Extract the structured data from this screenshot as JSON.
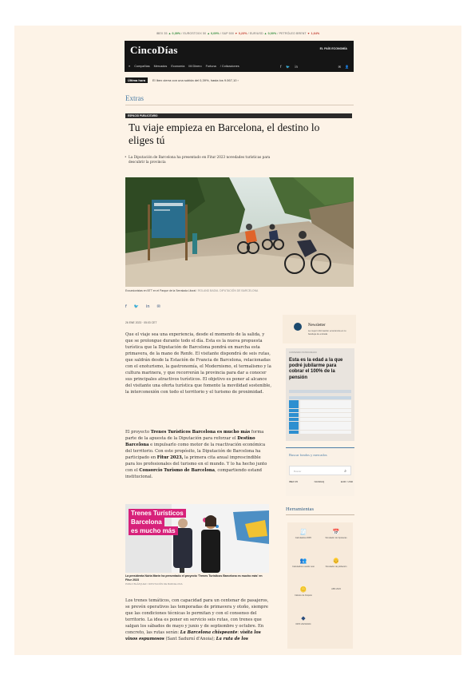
{
  "ticker": {
    "items": [
      {
        "name": "IBEX 35",
        "arrow": "▲",
        "value": "0,39%",
        "dir": "up"
      },
      {
        "name": "EUROSTOXX 50",
        "arrow": "▲",
        "value": "0,09%",
        "dir": "up"
      },
      {
        "name": "S&P 500",
        "arrow": "▼",
        "value": "0,23%",
        "dir": "down"
      },
      {
        "name": "EUR/USD",
        "arrow": "▲",
        "value": "0,00%",
        "dir": "up"
      },
      {
        "name": "PETRÓLEO BRENT",
        "arrow": "▼",
        "value": "1,64%",
        "dir": "down"
      }
    ]
  },
  "header": {
    "logo": "CincoDías",
    "partner": "EL PAÍS ECONOMÍA",
    "nav": [
      "Compañías",
      "Mercados",
      "Economía",
      "Mi Dinero",
      "Fortuna",
      "/ Cotizaciones"
    ],
    "menu_icon": "≡",
    "social_icons": [
      "f",
      "🐦",
      "in"
    ],
    "right_icons": [
      "✉",
      "👤"
    ]
  },
  "last_hour": {
    "tag": "Última hora",
    "text": "El Ibex cierra con una subida del 0,39%, hasta los 9.067,10 ›"
  },
  "section": "Extras",
  "article": {
    "promo_label": "ESPACIO PUBLICITARIO",
    "headline": "Tu viaje empieza en Barcelona, el destino lo eliges tú",
    "subhead": "La Diputación de Barcelona ha presentado en Fitur 2023 novedades turísticas para descubrir la provincia",
    "photo_caption": "Excursionistas en BTT en el Parque de la Serralada Litoral",
    "photo_credit": " / ROLAND BADIA. DIPUTACIÓN DE BARCELONA",
    "date": "26 ENE 2023 · 05:03 CET",
    "paragraph1": "Que el viaje sea una experiencia, desde el momento de la salida, y que se prolongue durante todo el día. Esta es la nueva propuesta turística que la Diputación de Barcelona pondrá en marcha esta primavera, de la mano de Renfe. El visitante dispondrá de seis rutas, que saldrán desde la Estación de Francia de Barcelona, relacionadas con el enoturismo, la gastronomía, el Modernismo, el termalismo y la cultura marinera, y que recorrerán la provincia para dar a conocer sus principales atractivos turísticos. El objetivo es poner al alcance del visitante una oferta turística que fomente la movilidad sostenible, la interconexión con todo el territorio y el turismo de proximidad.",
    "p2_a": "El proyecto ",
    "p2_b": "Trenes Turísticos Barcelona es mucho más",
    "p2_c": " forma parte de la apuesta de la Diputación para reforzar el ",
    "p2_d": "Destino Barcelona",
    "p2_e": " e impulsarlo como motor de la reactivación económica del territorio. Con este propósito, la Diputación de Barcelona ha participado en ",
    "p2_f": "Fitur 2023,",
    "p2_g": " la primera cita anual imprescindible para los profesionales del turismo en el mundo. Y lo ha hecho junto con el ",
    "p2_h": "Consorcio Turismo de Barcelona",
    "p2_i": ", compartiendo estand institucional.",
    "photo2_banner_1": "Trenes Turísticos",
    "photo2_banner_2": "Barcelona",
    "photo2_banner_3": "es mucho más",
    "photo2_caption": "La presidenta Núria Marín ha presentado el proyecto 'Trenes Turísticos Barcelona es mucho más' en Fitur 2023",
    "photo2_credit": "PABLO BLÁZQUEZ / DIPUTACIÓN DE BARCELONA",
    "p3_a": "Los trenes temáticos, con capacidad para un centenar de pasajeros, se prevén operativos las temporadas de primavera y otoño, siempre que las condiciones técnicas lo permitan y con el consenso del territorio. La idea es poner en servicio seis rutas, con trenes que salgan los sábados de mayo y junio y de septiembre y octubre. En concreto, las rutas serán: ",
    "p3_b": "La Barcelona chispeante",
    "p3_c": ": ",
    "p3_d": "visita los vinos espumosos",
    "p3_e": " (Sant Sadurní d'Anoia); ",
    "p3_f": "La ruta de los"
  },
  "share_icons": [
    "f",
    "🐦",
    "in",
    "✉"
  ],
  "sidebar": {
    "newsletter_title": "Newsletter",
    "newsletter_sub": "La mejor información económica en tu bandeja de entrada",
    "ad_label": "CONTENIDO PATROCINADO",
    "ad_title": "Esta es la edad a la que podré jubilarme para cobrar el 100% de la pensión",
    "markets_title": "Buscar fondos y mercados",
    "markets_placeholder": "Buscar",
    "indices": [
      "IBEX 35",
      "NASDAQ",
      "EUR / USD"
    ],
    "tools_title": "Herramientas",
    "tools": [
      {
        "icon": "🧾",
        "label": "Calculadora IRPF"
      },
      {
        "icon": "📅",
        "label": "Simulador de hipotecas"
      },
      {
        "icon": "👥",
        "label": "Calculadora sueldo neto"
      },
      {
        "icon": "👴",
        "label": "Simulador de jubilación"
      },
      {
        "icon": "🪙",
        "label": "Cálculo de finiquito"
      },
      {
        "icon": "",
        "label": "ABS 2023"
      },
      {
        "icon": "◆",
        "label": "IRPF 2023/2024"
      }
    ]
  },
  "colors": {
    "accent": "#4c7ea7",
    "header": "#151515",
    "page": "#fdf3e7"
  }
}
